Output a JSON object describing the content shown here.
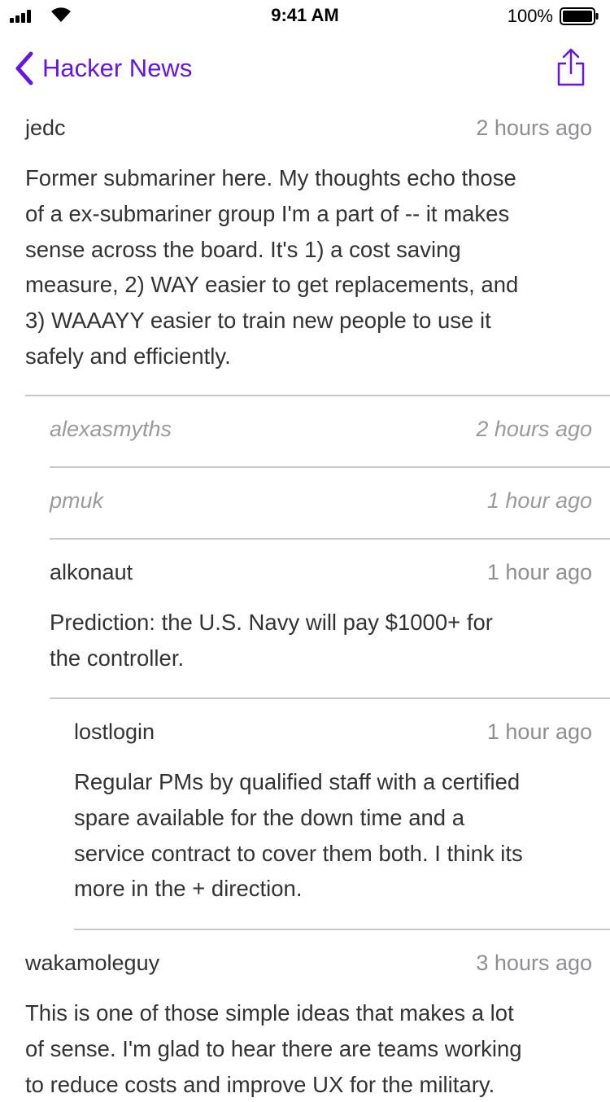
{
  "status_bar": {
    "time": "9:41 AM",
    "battery": "100%",
    "icons": [
      "signal-icon",
      "wifi-icon",
      "battery-icon"
    ]
  },
  "nav": {
    "back_label": "Hacker News",
    "icons": [
      "chevron-left-icon",
      "share-icon"
    ]
  },
  "colors": {
    "accent": "#6316e6",
    "meta_gray": "#8e8e93",
    "divider": "#c8c8c8"
  },
  "comments": [
    {
      "user": "jedc",
      "time": "2 hours ago",
      "lines": [
        "Former submariner here.  My thoughts echo those",
        "of a ex-submariner group I'm a part of -- it makes",
        "sense across the board.  It's 1) a cost saving",
        "measure, 2) WAY easier to get replacements, and",
        "3) WAAAYY easier to train new people to use it",
        "safely and efficiently."
      ]
    },
    {
      "user": "alexasmyths",
      "time": "2 hours ago",
      "collapsed": true
    },
    {
      "user": "pmuk",
      "time": "1 hour ago",
      "collapsed": true
    },
    {
      "user": "alkonaut",
      "time": "1 hour ago",
      "lines": [
        "Prediction: the U.S. Navy will pay $1000+ for",
        "the controller."
      ]
    },
    {
      "user": "lostlogin",
      "time": "1 hour ago",
      "lines": [
        "Regular PMs by qualified staff with a certified",
        "spare available for the down time and a",
        "service contract to cover them both. I think its",
        "more in the + direction."
      ]
    },
    {
      "user": "wakamoleguy",
      "time": "3 hours ago",
      "lines": [
        "This is one of those simple ideas that makes a lot",
        "of sense. I'm glad to hear there are teams working",
        "to reduce costs and improve UX for the military."
      ]
    }
  ]
}
